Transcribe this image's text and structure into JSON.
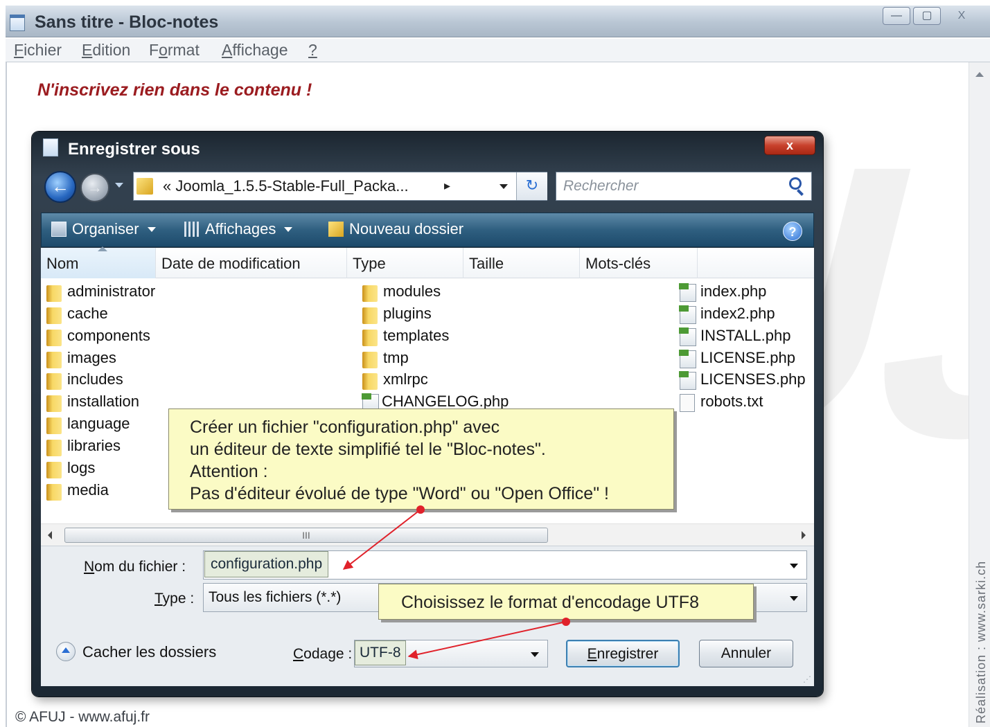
{
  "notepad": {
    "title": "Sans titre - Bloc-notes",
    "menu": [
      {
        "pre": "",
        "key": "F",
        "post": "ichier"
      },
      {
        "pre": "",
        "key": "E",
        "post": "dition"
      },
      {
        "pre": "F",
        "key": "o",
        "post": "rmat"
      },
      {
        "pre": "",
        "key": "A",
        "post": "ffichage"
      },
      {
        "pre": "",
        "key": "?",
        "post": ""
      }
    ],
    "minimize": "—",
    "maximize": "▢",
    "close": "X",
    "note": "N'inscrivez rien dans le contenu !"
  },
  "credit": "Réalisation : www.sarki.ch",
  "copyright": "© AFUJ - www.afuj.fr",
  "watermark": "AFUJ",
  "dialog": {
    "title": "Enregistrer sous",
    "close": "x",
    "address": "« Joomla_1.5.5-Stable-Full_Packa...",
    "address_arrow": "▸",
    "search_placeholder": "Rechercher",
    "toolbar": {
      "organiser": "Organiser",
      "affichages": "Affichages",
      "nouveau_dossier": "Nouveau dossier",
      "help": "?"
    },
    "columns": [
      "Nom",
      "Date de modification",
      "Type",
      "Taille",
      "Mots-clés"
    ],
    "items_col1": [
      "administrator",
      "cache",
      "components",
      "images",
      "includes",
      "installation",
      "language",
      "libraries",
      "logs",
      "media"
    ],
    "items_col2": [
      "modules",
      "plugins",
      "templates",
      "tmp",
      "xmlrpc",
      "CHANGELOG.php"
    ],
    "items_col3": [
      "index.php",
      "index2.php",
      "INSTALL.php",
      "LICENSE.php",
      "LICENSES.php",
      "robots.txt"
    ],
    "scroll_thumb": "III",
    "filename_label_key": "N",
    "filename_label_rest": "om du fichier :",
    "filename_value": "configuration.php",
    "type_label_key": "T",
    "type_label_rest": "ype :",
    "type_value": "Tous les fichiers  (*.*)",
    "hide_folders": "Cacher les dossiers",
    "encoding_label_key": "C",
    "encoding_label_rest": "odage :",
    "encoding_value": "UTF-8",
    "save_key": "E",
    "save_rest": "nregistrer",
    "cancel": "Annuler"
  },
  "callouts": {
    "main": [
      "Créer un fichier \"configuration.php\" avec",
      "un éditeur de texte simplifié tel le \"Bloc-notes\".",
      "Attention :",
      "Pas d'éditeur évolué de type \"Word\" ou \"Open Office\" !"
    ],
    "encoding": "Choisissez le format d'encodage UTF8"
  },
  "colors": {
    "note_red": "#9b1c20",
    "callout_bg": "#fbfbc5",
    "arrow_red": "#e0212a",
    "toolbar_blue": "#2f5f80"
  }
}
